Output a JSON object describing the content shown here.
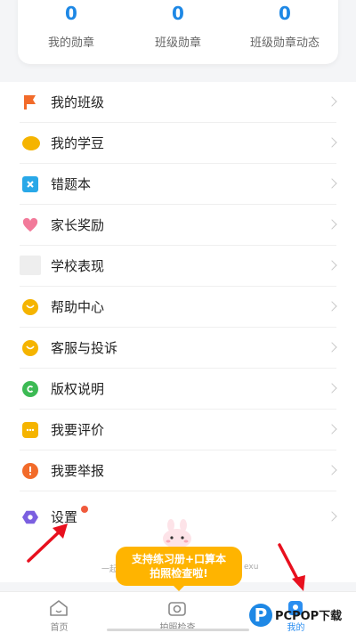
{
  "stats": [
    {
      "value": "0",
      "label": "我的勋章"
    },
    {
      "value": "0",
      "label": "班级勋章"
    },
    {
      "value": "0",
      "label": "班级勋章动态"
    }
  ],
  "menu": [
    {
      "label": "我的班级",
      "icon": "flag-icon",
      "color": "#f26b2a"
    },
    {
      "label": "我的学豆",
      "icon": "beans-icon",
      "color": "#f5b400"
    },
    {
      "label": "错题本",
      "icon": "notebook-icon",
      "color": "#29a8e8"
    },
    {
      "label": "家长奖励",
      "icon": "heart-icon",
      "color": "#f27a9a"
    },
    {
      "label": "学校表现",
      "icon": "blank-icon",
      "color": "#eeeeee"
    },
    {
      "label": "帮助中心",
      "icon": "help-icon",
      "color": "#f5b400"
    },
    {
      "label": "客服与投诉",
      "icon": "service-icon",
      "color": "#f5b400"
    },
    {
      "label": "版权说明",
      "icon": "copyright-icon",
      "color": "#3cba54"
    },
    {
      "label": "我要评价",
      "icon": "comment-icon",
      "color": "#f5b400"
    },
    {
      "label": "我要举报",
      "icon": "report-icon",
      "color": "#f26b2a"
    },
    {
      "label": "设置",
      "icon": "settings-icon",
      "color": "#7b5fe0"
    }
  ],
  "promo": {
    "line1": "支持练习册+口算本",
    "line2": "拍照检查啦!"
  },
  "faint_left": "一起",
  "faint_right": "exu",
  "tabs": [
    {
      "label": "首页",
      "icon": "home-icon"
    },
    {
      "label": "拍照检查",
      "icon": "camera-icon"
    },
    {
      "label": "我的",
      "icon": "profile-icon"
    }
  ],
  "watermark": "PCPOP下载",
  "colors": {
    "accent": "#1e88e5",
    "promo": "#ffb400",
    "arrow": "#e8101e",
    "badge_dot": "#f05a3c"
  }
}
